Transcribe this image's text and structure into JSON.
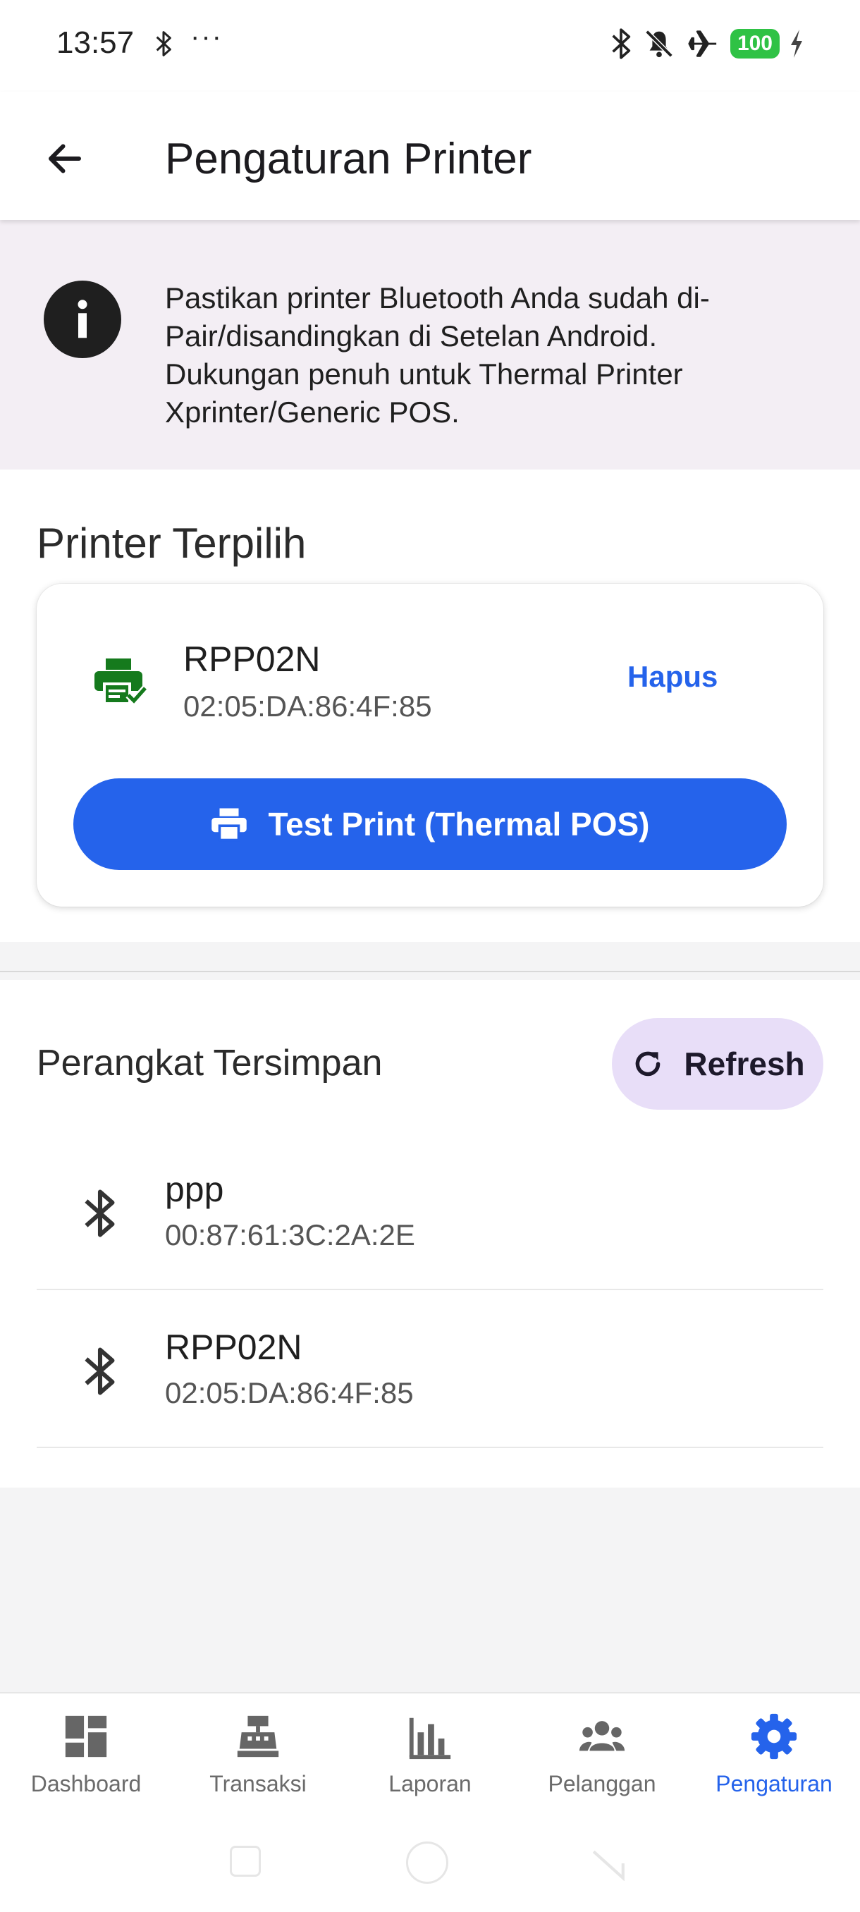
{
  "status_bar": {
    "time": "13:57",
    "dots": "···",
    "battery": "100",
    "icons": [
      "bluetooth-icon",
      "bell-off-icon",
      "airplane-icon",
      "battery-icon",
      "charging-icon"
    ]
  },
  "app_bar": {
    "title": "Pengaturan Printer",
    "back_icon": "arrow-left-icon"
  },
  "info_banner": {
    "icon": "info-icon",
    "text": "Pastikan printer Bluetooth Anda sudah di-Pair/disandingkan di Setelan Android. Dukungan penuh untuk Thermal Printer Xprinter/Generic POS."
  },
  "selected_printer": {
    "section_title": "Printer Terpilih",
    "name": "RPP02N",
    "mac": "02:05:DA:86:4F:85",
    "remove_label": "Hapus",
    "test_button_label": "Test Print (Thermal POS)",
    "icon": "printer-check-icon",
    "accent_color": "#2563eb",
    "icon_color": "#157a1d"
  },
  "saved_devices": {
    "section_title": "Perangkat Tersimpan",
    "refresh_label": "Refresh",
    "items": [
      {
        "name": "ppp",
        "mac": "00:87:61:3C:2A:2E"
      },
      {
        "name": "RPP02N",
        "mac": "02:05:DA:86:4F:85"
      }
    ]
  },
  "bottom_nav": {
    "items": [
      {
        "label": "Dashboard",
        "icon": "dashboard-icon"
      },
      {
        "label": "Transaksi",
        "icon": "cash-register-icon"
      },
      {
        "label": "Laporan",
        "icon": "bar-chart-icon"
      },
      {
        "label": "Pelanggan",
        "icon": "people-icon"
      },
      {
        "label": "Pengaturan",
        "icon": "gear-icon",
        "active": true
      }
    ]
  }
}
